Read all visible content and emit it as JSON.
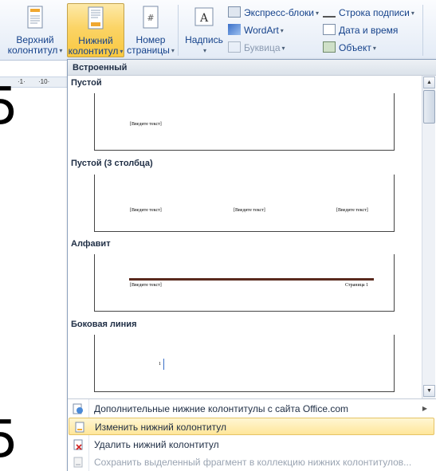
{
  "ribbon": {
    "header_btn": {
      "line1": "Верхний",
      "line2": "колонтитул"
    },
    "footer_btn": {
      "line1": "Нижний",
      "line2": "колонтитул"
    },
    "pagenum_btn": {
      "line1": "Номер",
      "line2": "страницы"
    },
    "textbox_btn": {
      "label": "Надпись"
    },
    "quickparts": "Экспресс-блоки",
    "wordart": "WordArt",
    "dropcap": "Буквица",
    "signature": "Строка подписи",
    "datetime": "Дата и время",
    "object": "Объект",
    "dropdown_arrow": "▾",
    "accent_color": "#fbd466"
  },
  "document": {
    "ruler_numbers": [
      "·1·",
      "·10·"
    ],
    "glyph_top": "5",
    "glyph_bottom": "5"
  },
  "gallery": {
    "header": "Встроенный",
    "items": [
      {
        "title": "Пустой",
        "texts": [
          "[Введите текст]"
        ]
      },
      {
        "title": "Пустой (3 столбца)",
        "texts": [
          "[Введите текст]",
          "[Введите текст]",
          "[Введите текст]"
        ]
      },
      {
        "title": "Алфавит",
        "texts": [
          "[Введите текст]",
          "Страница 1"
        ]
      },
      {
        "title": "Боковая линия",
        "texts": [
          "1"
        ]
      }
    ],
    "scroll_up": "▲",
    "scroll_down": "▼"
  },
  "menu": {
    "more_online": "Дополнительные нижние колонтитулы с сайта Office.com",
    "edit_footer": "Изменить нижний колонтитул",
    "remove_footer": "Удалить нижний колонтитул",
    "save_selection": "Сохранить выделенный фрагмент в коллекцию нижних колонтитулов...",
    "submenu_arrow": "▶"
  }
}
